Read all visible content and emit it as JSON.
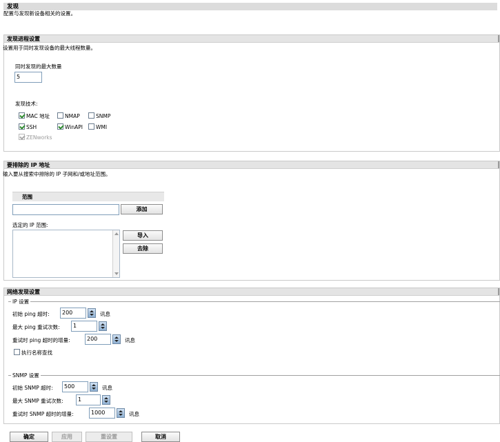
{
  "page": {
    "title": "发现",
    "subtitle": "配置与发现新设备相关的设置。"
  },
  "discovery_threads": {
    "title": "发现进程设置",
    "description": "设置用于同时发现设备的最大线程数量。",
    "max_label": "同时发现的最大数量",
    "max_value": "5",
    "tech_label": "发现技术:",
    "techniques": [
      {
        "label": "MAC 地址",
        "checked": true,
        "disabled": false
      },
      {
        "label": "NMAP",
        "checked": false,
        "disabled": false
      },
      {
        "label": "SNMP",
        "checked": false,
        "disabled": false
      },
      {
        "label": "SSH",
        "checked": true,
        "disabled": false
      },
      {
        "label": "WinAPI",
        "checked": true,
        "disabled": false
      },
      {
        "label": "WMI",
        "checked": false,
        "disabled": false
      },
      {
        "label": "ZENworks",
        "checked": true,
        "disabled": true
      }
    ]
  },
  "exclude_ip": {
    "title": "要排除的 IP 地址",
    "description": "输入要从搜索中排除的 IP 子网和/或地址范围。",
    "range_header": "范围",
    "range_value": "",
    "add_button": "添加",
    "selected_label": "选定的 IP 范围:",
    "import_button": "导入",
    "remove_button": "去除"
  },
  "network_discovery": {
    "title": "网络发现设置",
    "ip_legend": "IP 设置",
    "ping_timeout_label": "初始 ping 超时:",
    "ping_timeout_value": "200",
    "ping_timeout_unit": "讯息",
    "ping_retries_label": "最大 ping 重试次数:",
    "ping_retries_value": "1",
    "ping_increment_label": "重试时 ping 超时的增量:",
    "ping_increment_value": "200",
    "ping_increment_unit": "讯息",
    "name_lookup_label": "执行名称查找",
    "name_lookup_checked": false,
    "snmp_legend": "SNMP 设置",
    "snmp_timeout_label": "初始 SNMP 超时:",
    "snmp_timeout_value": "500",
    "snmp_timeout_unit": "讯息",
    "snmp_retries_label": "最大 SNMP 重试次数:",
    "snmp_retries_value": "1",
    "snmp_increment_label": "重试时 SNMP 超时的增量:",
    "snmp_increment_value": "1000",
    "snmp_increment_unit": "讯息"
  },
  "footer": {
    "ok": "确定",
    "apply": "应用",
    "reset": "重设置",
    "cancel": "取消"
  }
}
